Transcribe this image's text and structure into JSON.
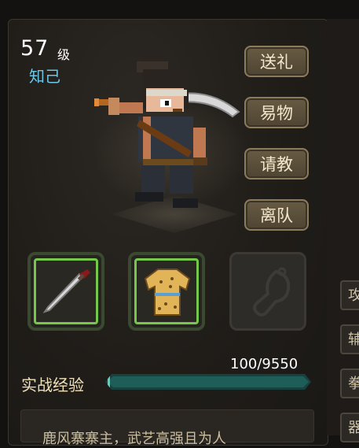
{
  "character": {
    "level": "57",
    "level_unit": "级",
    "rank": "知己"
  },
  "actions": [
    {
      "label": "送礼"
    },
    {
      "label": "易物"
    },
    {
      "label": "请教"
    },
    {
      "label": "离队"
    }
  ],
  "equipment": [
    {
      "slot": "weapon",
      "icon": "machete-icon",
      "equipped": true
    },
    {
      "slot": "armor",
      "icon": "leopard-vest-icon",
      "equipped": true
    },
    {
      "slot": "accessory",
      "icon": "empty-accessory-icon",
      "equipped": false
    }
  ],
  "experience": {
    "label": "实战经验",
    "value_text": "100/9550",
    "current": 100,
    "max": 9550
  },
  "description": {
    "text": "鹿风寨寨主，武艺高强且为人"
  },
  "side_tabs": [
    {
      "label": "攻"
    },
    {
      "label": "辅"
    },
    {
      "label": "拳"
    },
    {
      "label": "器"
    }
  ],
  "colors": {
    "rank": "#6ec6e6",
    "equipped_border": "#76c84a",
    "exp_fill": "#5fd0b8"
  }
}
